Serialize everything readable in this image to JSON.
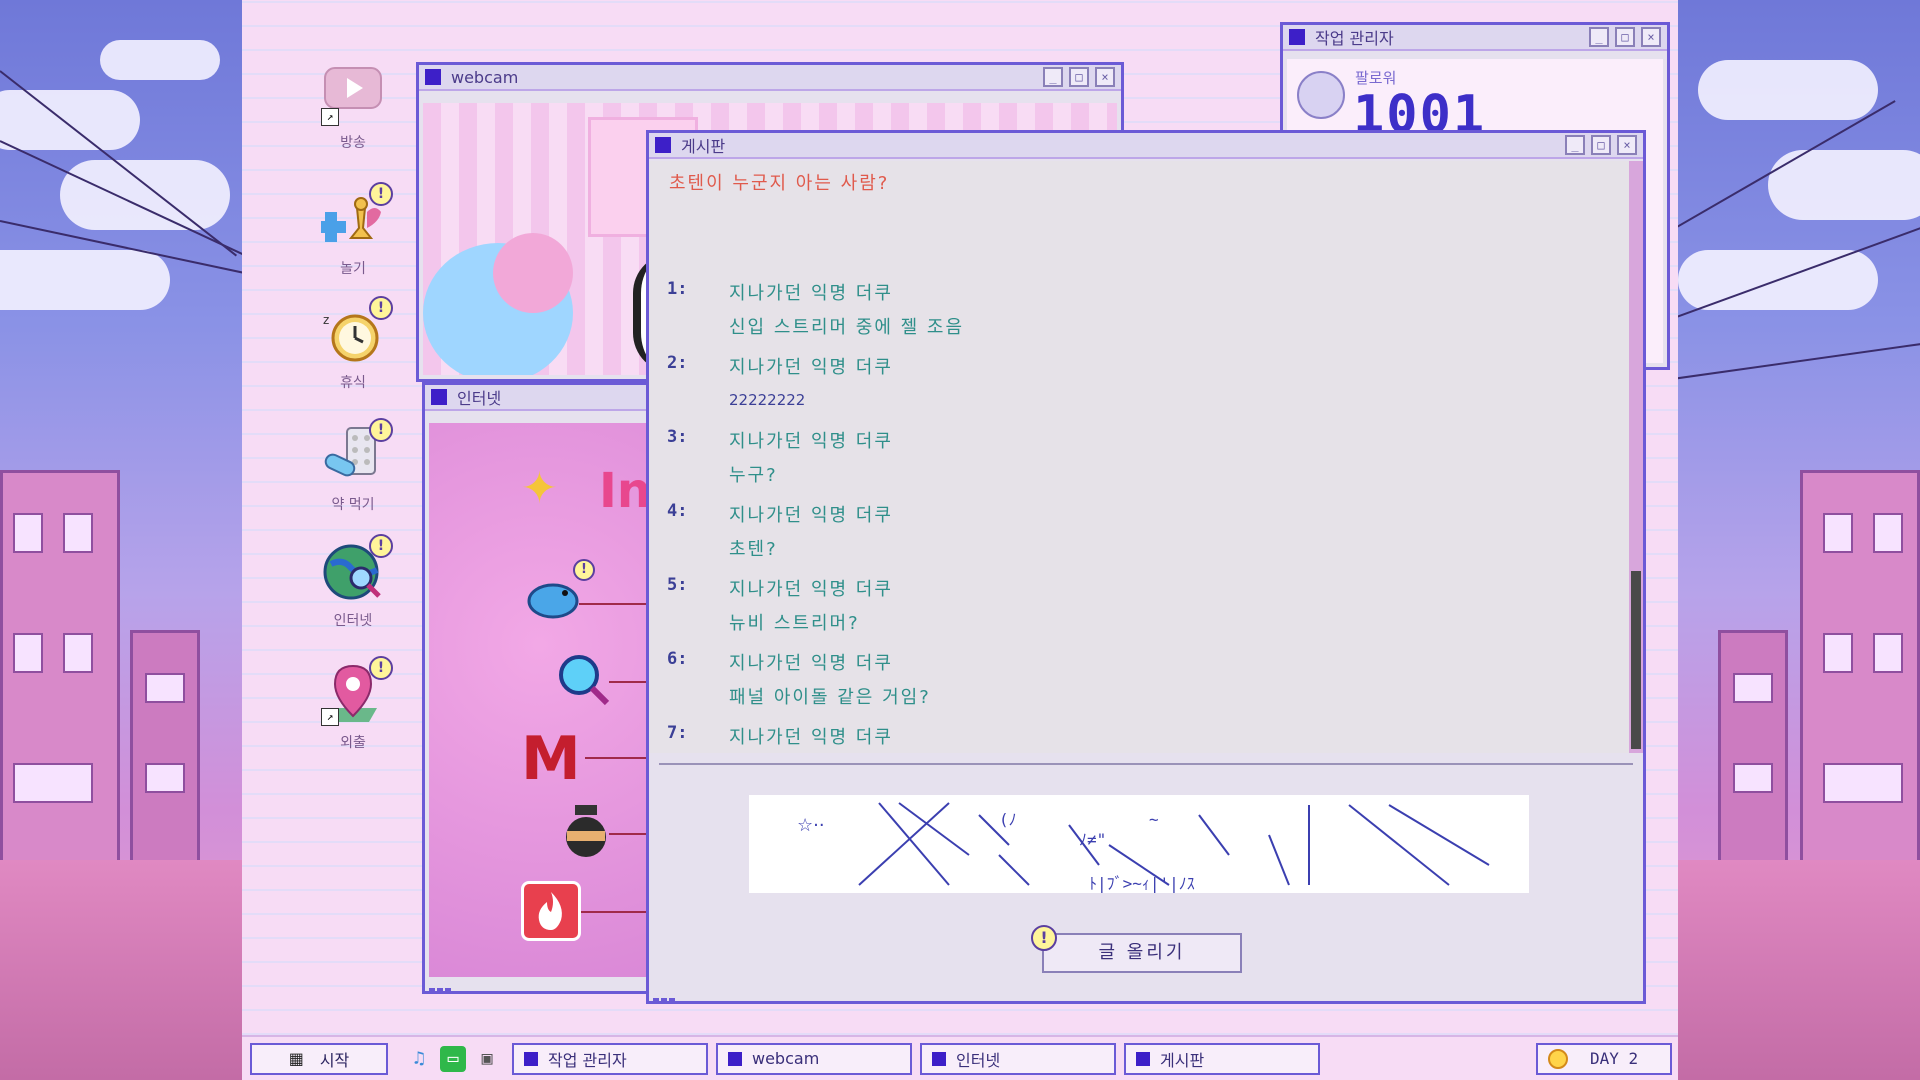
{
  "desktop_icons": [
    {
      "label": "방송",
      "icon": "broadcast-icon",
      "badge": ""
    },
    {
      "label": "놀기",
      "icon": "play-icon",
      "badge": "!"
    },
    {
      "label": "휴식",
      "icon": "alarm-clock-icon",
      "badge": "!"
    },
    {
      "label": "약 먹기",
      "icon": "pill-icon",
      "badge": "!"
    },
    {
      "label": "인터넷",
      "icon": "globe-icon",
      "badge": "!"
    },
    {
      "label": "외출",
      "icon": "map-pin-icon",
      "badge": "!"
    }
  ],
  "windows": {
    "webcam": {
      "title": "webcam"
    },
    "internet": {
      "title": "인터넷",
      "partial_logo": "In"
    },
    "task_manager": {
      "title": "작업 관리자",
      "followers_label": "팔로워",
      "followers_value": "1001"
    },
    "bbs": {
      "title": "게시판",
      "thread_title": "초텐이 누군지 아는 사람?",
      "posts": [
        {
          "num": "1:",
          "author": "지나가던 익명 더쿠",
          "text": "신입 스트리머 중에 젤 조음"
        },
        {
          "num": "2:",
          "author": "지나가던 익명 더쿠",
          "text": "22222222"
        },
        {
          "num": "3:",
          "author": "지나가던 익명 더쿠",
          "text": "누구?"
        },
        {
          "num": "4:",
          "author": "지나가던 익명 더쿠",
          "text": "초텐?"
        },
        {
          "num": "5:",
          "author": "지나가던 익명 더쿠",
          "text": "뉴비 스트리머?"
        },
        {
          "num": "6:",
          "author": "지나가던 익명 더쿠",
          "text": "패널 아이돌 같은 거임?"
        },
        {
          "num": "7:",
          "author": "지나가던 익명 더쿠",
          "text": ""
        }
      ],
      "post_button": "글 올리기",
      "post_button_badge": "!"
    }
  },
  "taskbar": {
    "start_label": "시작",
    "tasks": [
      "작업 관리자",
      "webcam",
      "인터넷",
      "게시판"
    ],
    "day_label": "DAY 2"
  },
  "colors": {
    "accent": "#3d1fc8",
    "thread_title": "#e05a4c",
    "post_text": "#2f8f8a"
  }
}
